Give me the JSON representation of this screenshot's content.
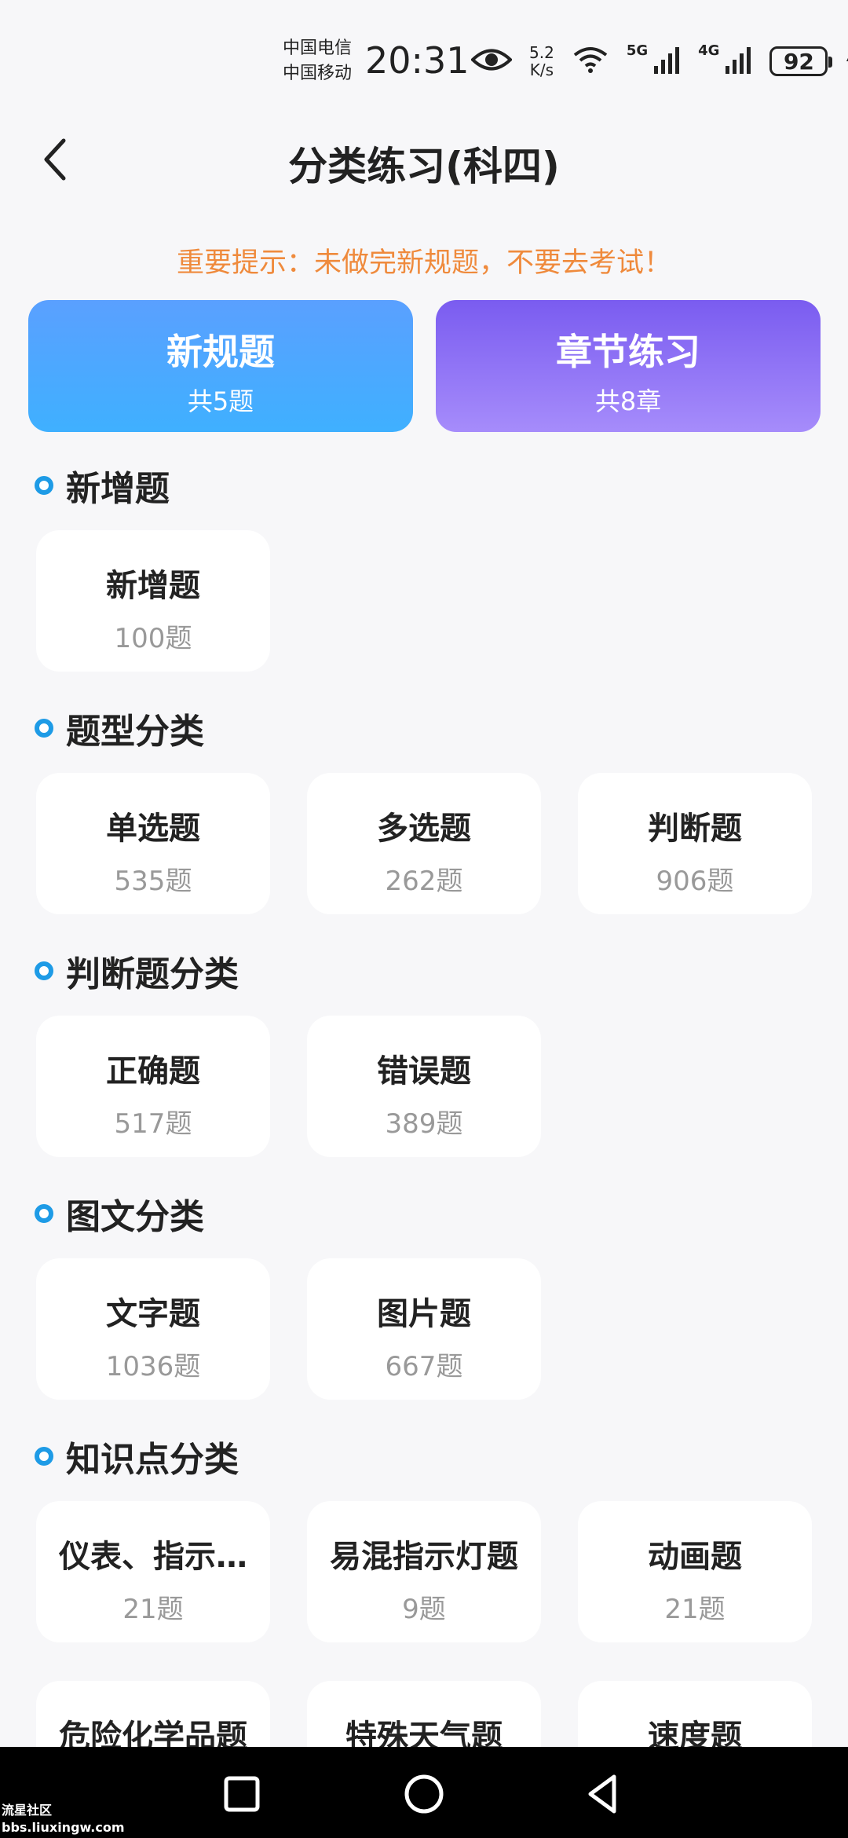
{
  "status": {
    "carrier1": "中国电信",
    "carrier2": "中国移动",
    "time": "20:31",
    "speed_value": "5.2",
    "speed_unit": "K/s",
    "sig1": "5G",
    "sig2": "4G",
    "battery": "92"
  },
  "header": {
    "title": "分类练习(科四)"
  },
  "notice": "重要提示：未做完新规题，不要去考试！",
  "top_buttons": [
    {
      "title": "新规题",
      "sub": "共5题"
    },
    {
      "title": "章节练习",
      "sub": "共8章"
    }
  ],
  "sections": [
    {
      "title": "新增题",
      "items": [
        {
          "label": "新增题",
          "count": "100题"
        }
      ]
    },
    {
      "title": "题型分类",
      "items": [
        {
          "label": "单选题",
          "count": "535题"
        },
        {
          "label": "多选题",
          "count": "262题"
        },
        {
          "label": "判断题",
          "count": "906题"
        }
      ]
    },
    {
      "title": "判断题分类",
      "items": [
        {
          "label": "正确题",
          "count": "517题"
        },
        {
          "label": "错误题",
          "count": "389题"
        }
      ]
    },
    {
      "title": "图文分类",
      "items": [
        {
          "label": "文字题",
          "count": "1036题"
        },
        {
          "label": "图片题",
          "count": "667题"
        }
      ]
    },
    {
      "title": "知识点分类",
      "items": [
        {
          "label": "仪表、指示…",
          "count": "21题"
        },
        {
          "label": "易混指示灯题",
          "count": "9题"
        },
        {
          "label": "动画题",
          "count": "21题"
        },
        {
          "label": "危险化学品题",
          "count": ""
        },
        {
          "label": "特殊天气题",
          "count": ""
        },
        {
          "label": "速度题",
          "count": ""
        }
      ]
    }
  ],
  "watermark": {
    "line1": "流星社区",
    "line2": "bbs.liuxingw.com"
  },
  "colors": {
    "accent": "#1e9be6",
    "notice": "#ef8a3c",
    "blue_btn": "#4aa8ff",
    "purple_btn": "#8f74f6"
  }
}
